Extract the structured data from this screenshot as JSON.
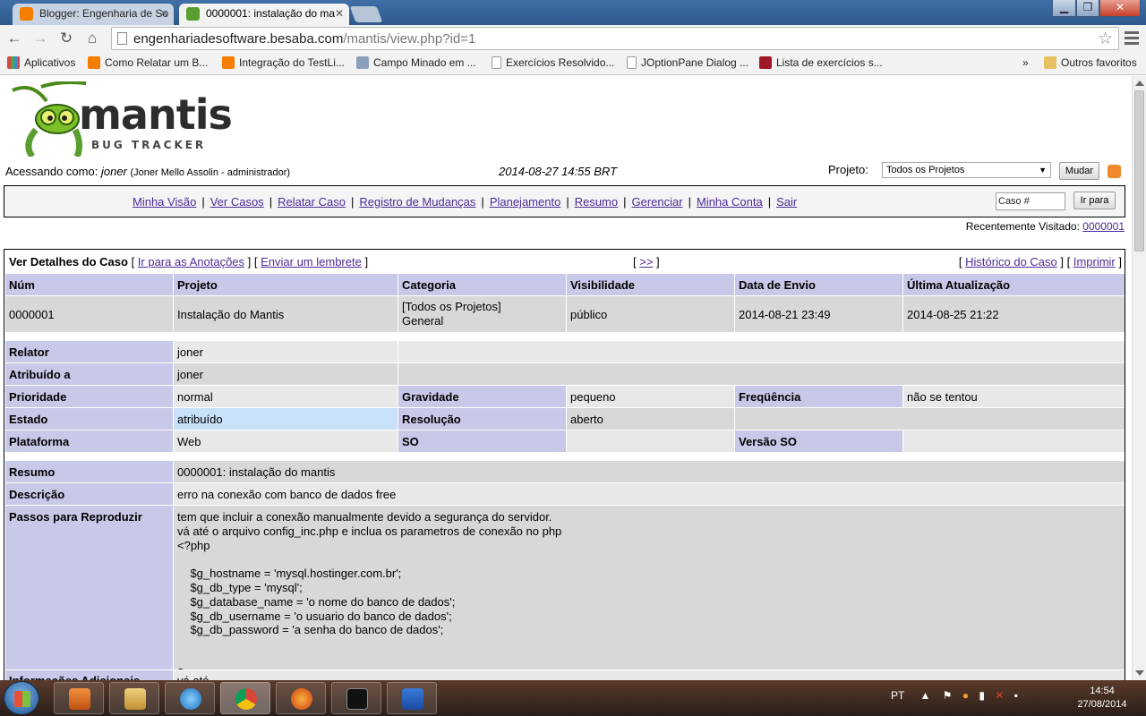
{
  "browser": {
    "tabs": [
      {
        "title": "Blogger: Engenharia de So",
        "icon": "blogger-icon",
        "active": false
      },
      {
        "title": "0000001: instalação do ma",
        "icon": "mantis-icon",
        "active": true
      }
    ],
    "url_host": "engenhariadesoftware.besaba.com",
    "url_path": "/mantis/view.php?id=1",
    "bookmarks": [
      {
        "label": "Aplicativos",
        "icon": "apps-icon"
      },
      {
        "label": "Como Relatar um B...",
        "icon": "blogger-icon"
      },
      {
        "label": "Integração do TestLi...",
        "icon": "blogger-icon"
      },
      {
        "label": "Campo Minado em ...",
        "icon": "image-icon"
      },
      {
        "label": "Exercícios Resolvido...",
        "icon": "page-icon"
      },
      {
        "label": "JOptionPane Dialog ...",
        "icon": "page-icon"
      },
      {
        "label": "Lista de exercícios s...",
        "icon": "dice-icon"
      }
    ],
    "more": "»",
    "other_bookmarks": "Outros favoritos"
  },
  "mantis": {
    "logo_word": "mantis",
    "logo_sub": "BUG TRACKER",
    "login_prefix": "Acessando como:",
    "user": "joner",
    "user_detail": "(Joner Mello Assolin - administrador)",
    "datetime": "2014-08-27 14:55 BRT",
    "project_label": "Projeto:",
    "project_value": "Todos os Projetos",
    "change_button": "Mudar",
    "menu": [
      "Minha Visão",
      "Ver Casos",
      "Relatar Caso",
      "Registro de Mudanças",
      "Planejamento",
      "Resumo",
      "Gerenciar",
      "Minha Conta",
      "Sair"
    ],
    "case_placeholder": "Caso #",
    "goto_button": "Ir para",
    "recent_label": "Recentemente Visitado:",
    "recent_id": "0000001"
  },
  "issue": {
    "section_title": "Ver Detalhes do Caso",
    "jump_notes": "Ir para as Anotações",
    "send_reminder": "Enviar um lembrete",
    "next": ">>",
    "history": "Histórico do Caso",
    "print": "Imprimir",
    "headers": [
      "Núm",
      "Projeto",
      "Categoria",
      "Visibilidade",
      "Data de Envio",
      "Última Atualização"
    ],
    "values": [
      "0000001",
      "Instalação do Mantis",
      "[Todos os Projetos]",
      "público",
      "2014-08-21 23:49",
      "2014-08-25 21:22"
    ],
    "category_sub": "General",
    "reporter_label": "Relator",
    "reporter": "joner",
    "assigned_label": "Atribuído a",
    "assigned": "joner",
    "priority_label": "Prioridade",
    "priority": "normal",
    "severity_label": "Gravidade",
    "severity": "pequeno",
    "frequency_label": "Freqüência",
    "frequency": "não se tentou",
    "status_label": "Estado",
    "status": "atribuído",
    "resolution_label": "Resolução",
    "resolution": "aberto",
    "platform_label": "Plataforma",
    "platform": "Web",
    "os_label": "SO",
    "os": "",
    "os_version_label": "Versão SO",
    "os_version": "",
    "summary_label": "Resumo",
    "summary": "0000001: instalação do mantis",
    "description_label": "Descrição",
    "description": "erro na conexão com banco de dados free",
    "steps_label": "Passos para Reproduzir",
    "steps": "tem que incluir a conexão manualmente devido a segurança do servidor.\nvá até o arquivo config_inc.php e inclua os parametros de conexão no php\n<?php\n\n    $g_hostname = 'mysql.hostinger.com.br';\n    $g_db_type = 'mysql';\n    $g_database_name = 'o nome do banco de dados';\n    $g_db_username = 'o usuario do banco de dados';\n    $g_db_password = 'a senha do banco de dados';\n\n\n?>",
    "additional_label": "Informações Adicionais",
    "additional": "vá até ..."
  },
  "taskbar": {
    "lang": "PT",
    "time": "14:54",
    "date": "27/08/2014"
  }
}
